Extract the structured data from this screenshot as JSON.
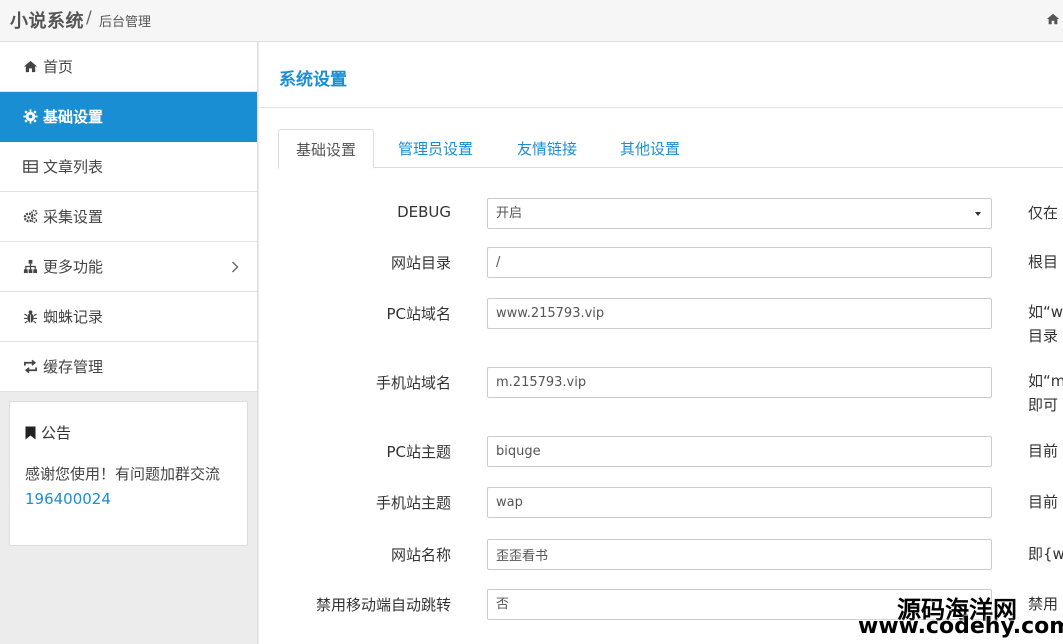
{
  "header": {
    "brand": "小说系统",
    "separator": "/",
    "subtitle": "后台管理"
  },
  "sidebar": {
    "items": [
      {
        "label": "首页",
        "icon": "home-icon"
      },
      {
        "label": "基础设置",
        "icon": "gear-icon",
        "active": true
      },
      {
        "label": "文章列表",
        "icon": "table-icon"
      },
      {
        "label": "采集设置",
        "icon": "gears-icon"
      },
      {
        "label": "更多功能",
        "icon": "sitemap-icon"
      },
      {
        "label": "蜘蛛记录",
        "icon": "bug-icon"
      },
      {
        "label": "缓存管理",
        "icon": "refresh-icon"
      }
    ],
    "notice": {
      "title": "公告",
      "text": "感谢您使用！有问题加群交流",
      "link": "196400024"
    }
  },
  "main": {
    "title": "系统设置",
    "tabs": [
      {
        "label": "基础设置",
        "active": true
      },
      {
        "label": "管理员设置"
      },
      {
        "label": "友情链接"
      },
      {
        "label": "其他设置"
      }
    ],
    "form": [
      {
        "label": "DEBUG",
        "value": "开启",
        "type": "select",
        "help": [
          "仅在"
        ]
      },
      {
        "label": "网站目录",
        "value": "/",
        "type": "input",
        "help": [
          "根目"
        ]
      },
      {
        "label": "PC站域名",
        "value": "www.215793.vip",
        "type": "input",
        "help": [
          "如“w",
          "目录"
        ]
      },
      {
        "label": "手机站域名",
        "value": "m.215793.vip",
        "type": "input",
        "help": [
          "如“m",
          "即可"
        ]
      },
      {
        "label": "PC站主题",
        "value": "biquge",
        "type": "input",
        "help": [
          "目前"
        ]
      },
      {
        "label": "手机站主题",
        "value": "wap",
        "type": "input",
        "help": [
          "目前"
        ]
      },
      {
        "label": "网站名称",
        "value": "歪歪看书",
        "type": "input",
        "help": [
          "即{w"
        ]
      },
      {
        "label": "禁用移动端自动跳转",
        "value": "否",
        "type": "select",
        "help": [
          "禁用"
        ]
      }
    ]
  },
  "watermark": {
    "line1": "源码海洋网",
    "line2": "www.codehy.com"
  },
  "colors": {
    "accent": "#1a8ed3",
    "sidebar_bg": "#ececec"
  }
}
